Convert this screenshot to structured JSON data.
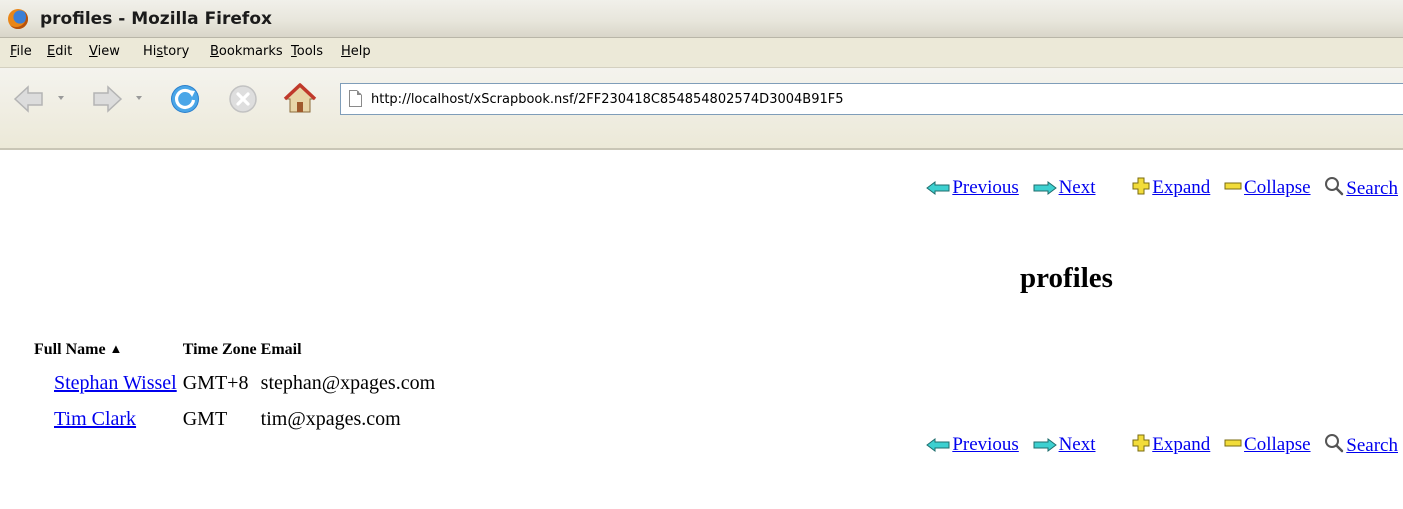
{
  "window": {
    "title": "profiles - Mozilla Firefox"
  },
  "menu": [
    {
      "accel": "F",
      "rest": "ile"
    },
    {
      "accel": "E",
      "rest": "dit"
    },
    {
      "accel": "V",
      "rest": "iew"
    },
    {
      "pre": "Hi",
      "accel": "s",
      "rest": "tory"
    },
    {
      "accel": "B",
      "rest": "ookmarks"
    },
    {
      "accel": "T",
      "rest": "ools"
    },
    {
      "accel": "H",
      "rest": "elp"
    }
  ],
  "toolbar": {
    "url": "http://localhost/xScrapbook.nsf/2FF230418C854854802574D3004B91F5",
    "back_icon": "back-arrow-icon",
    "forward_icon": "forward-arrow-icon",
    "reload_icon": "reload-icon",
    "stop_icon": "stop-icon",
    "home_icon": "home-icon"
  },
  "actions": {
    "previous": "Previous",
    "next": "Next",
    "expand": "Expand",
    "collapse": "Collapse",
    "search": "Search"
  },
  "page": {
    "title": "profiles"
  },
  "table": {
    "columns": [
      "Full Name",
      "Time Zone",
      "Email"
    ],
    "rows": [
      {
        "name": "Stephan Wissel",
        "timezone": "GMT+8",
        "email": "stephan@xpages.com"
      },
      {
        "name": "Tim Clark",
        "timezone": "GMT",
        "email": "tim@xpages.com"
      }
    ]
  },
  "colors": {
    "link": "#0000ee",
    "chrome": "#ece9d8"
  }
}
